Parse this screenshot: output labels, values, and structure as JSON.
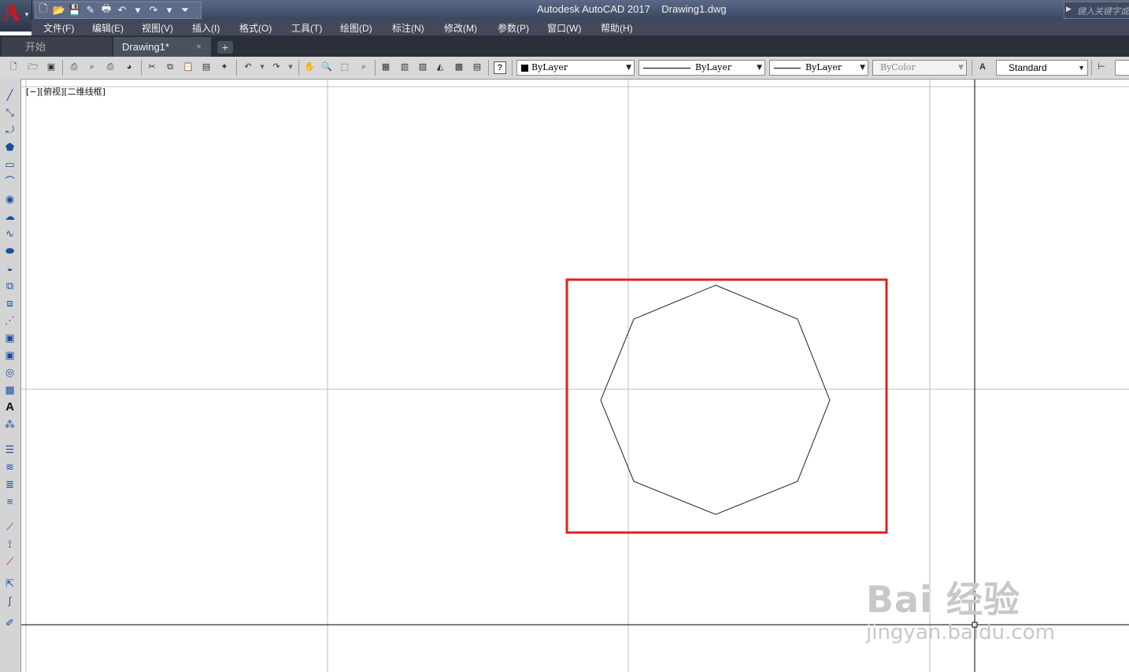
{
  "titlebar": {
    "title": "Autodesk AutoCAD 2017    Drawing1.dwg",
    "search_placeholder": "键入关键字或"
  },
  "menu": [
    "文件(F)",
    "编辑(E)",
    "视图(V)",
    "插入(I)",
    "格式(O)",
    "工具(T)",
    "绘图(D)",
    "标注(N)",
    "修改(M)",
    "参数(P)",
    "窗口(W)",
    "帮助(H)"
  ],
  "tabs": {
    "start": "开始",
    "drawing": "Drawing1*",
    "close": "×",
    "add": "+"
  },
  "properties": {
    "color": "ByLayer",
    "linetype": "ByLayer",
    "lineweight": "ByLayer",
    "plotstyle": "ByColor",
    "textstyle": "Standard"
  },
  "viewport": {
    "label": "[−][俯视][二维线框]"
  },
  "watermark": {
    "brand": "Bai 经验",
    "url": "jingyan.baidu.com"
  },
  "colors": {
    "highlight_box": "#e02020",
    "logo": "#d4141c"
  }
}
